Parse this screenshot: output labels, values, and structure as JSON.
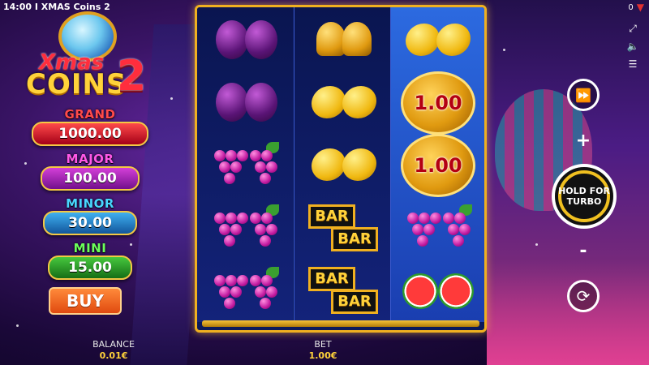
{
  "topbar": {
    "time": "14:00",
    "separator": "I",
    "game_title": "XMAS Coins 2",
    "counter": "0"
  },
  "logo": {
    "line1": "Xmas",
    "line2": "COINS",
    "number": "2"
  },
  "jackpots": {
    "grand": {
      "label": "GRAND",
      "value": "1000.00"
    },
    "major": {
      "label": "MAJOR",
      "value": "100.00"
    },
    "minor": {
      "label": "MINOR",
      "value": "30.00"
    },
    "mini": {
      "label": "MINI",
      "value": "15.00"
    }
  },
  "buy_label": "BUY",
  "reels": [
    [
      "plum",
      "plum",
      "grapes",
      "grapes",
      "grapes"
    ],
    [
      "bell",
      "lemon",
      "lemon",
      "bar",
      "bar"
    ],
    [
      "lemon",
      "coin",
      "coin",
      "grapes",
      "watermelon"
    ]
  ],
  "coins": {
    "coin1": "1.00",
    "coin2": "1.00"
  },
  "bar_text": "BAR",
  "controls": {
    "spin_line1": "HOLD FOR",
    "spin_line2": "TURBO",
    "plus": "+",
    "minus": "-"
  },
  "footer": {
    "balance_label": "BALANCE",
    "balance_value": "0.01€",
    "bet_label": "BET",
    "bet_value": "1.00€"
  },
  "colors": {
    "reel_frame": "#f0b020",
    "grand": "#ff4a4a",
    "major": "#d43fd8",
    "minor": "#3fb0f0",
    "mini": "#46c83e",
    "buy": "#ff8a3a"
  }
}
